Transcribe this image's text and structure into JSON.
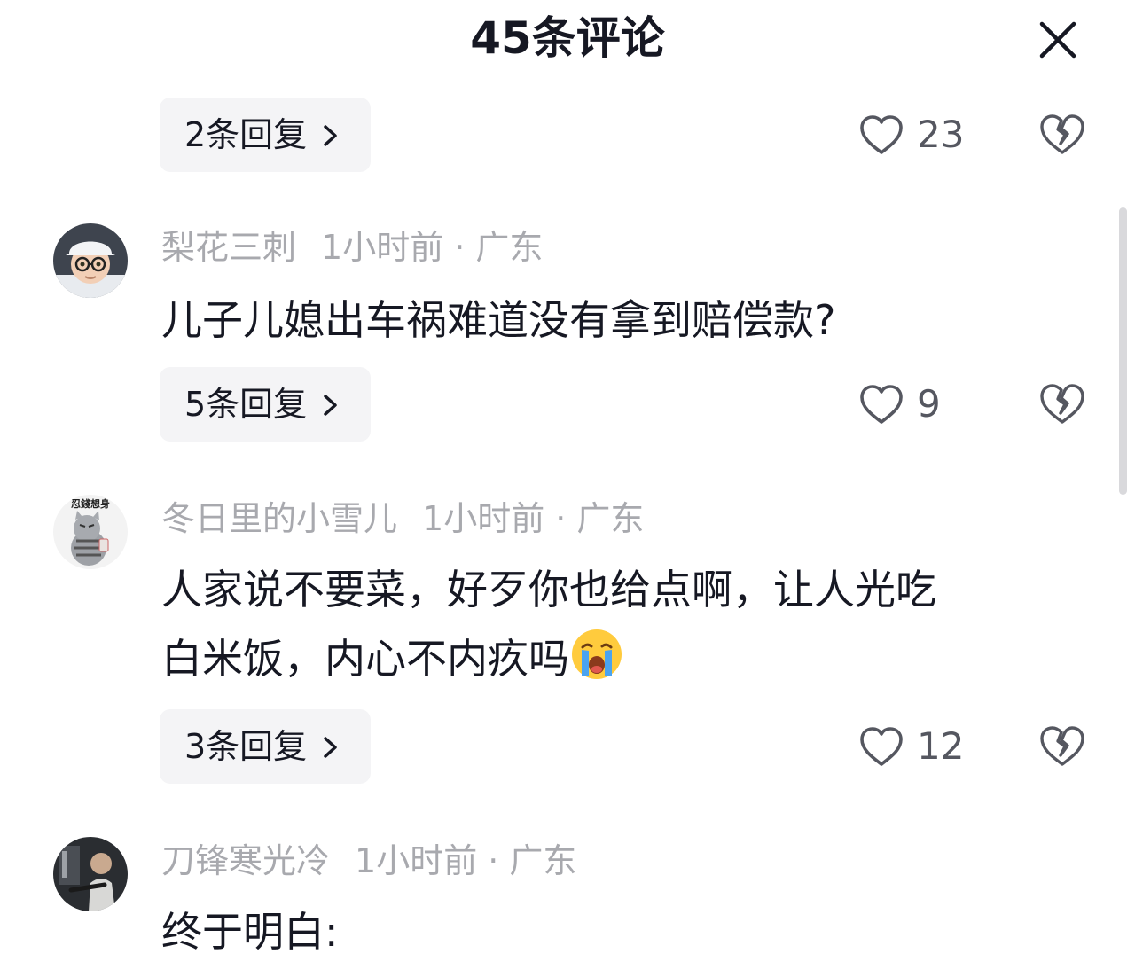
{
  "header": {
    "title": "45条评论"
  },
  "top_item": {
    "reply_label": "2条回复",
    "likes": "23"
  },
  "comments": [
    {
      "username": "梨花三刺",
      "time_location": "1小时前 · 广东",
      "text": "儿子儿媳出车祸难道没有拿到赔偿款?",
      "reply_label": "5条回复",
      "likes": "9"
    },
    {
      "username": "冬日里的小雪儿",
      "avatar_text": "忍錢想身",
      "time_location": "1小时前 · 广东",
      "text_line1": "人家说不要菜，好歹你也给点啊，让人光吃",
      "text_line2": "白米饭，内心不内疚吗",
      "reply_label": "3条回复",
      "likes": "12"
    },
    {
      "username": "刀锋寒光冷",
      "time_location": "1小时前 · 广东",
      "text": "终于明白:"
    }
  ],
  "colors": {
    "text_primary": "#161823",
    "text_meta": "#a8a9ae",
    "reply_bg": "#f4f4f6",
    "icon": "#555760"
  },
  "icons": [
    "close-icon",
    "heart-icon",
    "broken-heart-icon",
    "chevron-right-icon",
    "crying-emoji"
  ]
}
